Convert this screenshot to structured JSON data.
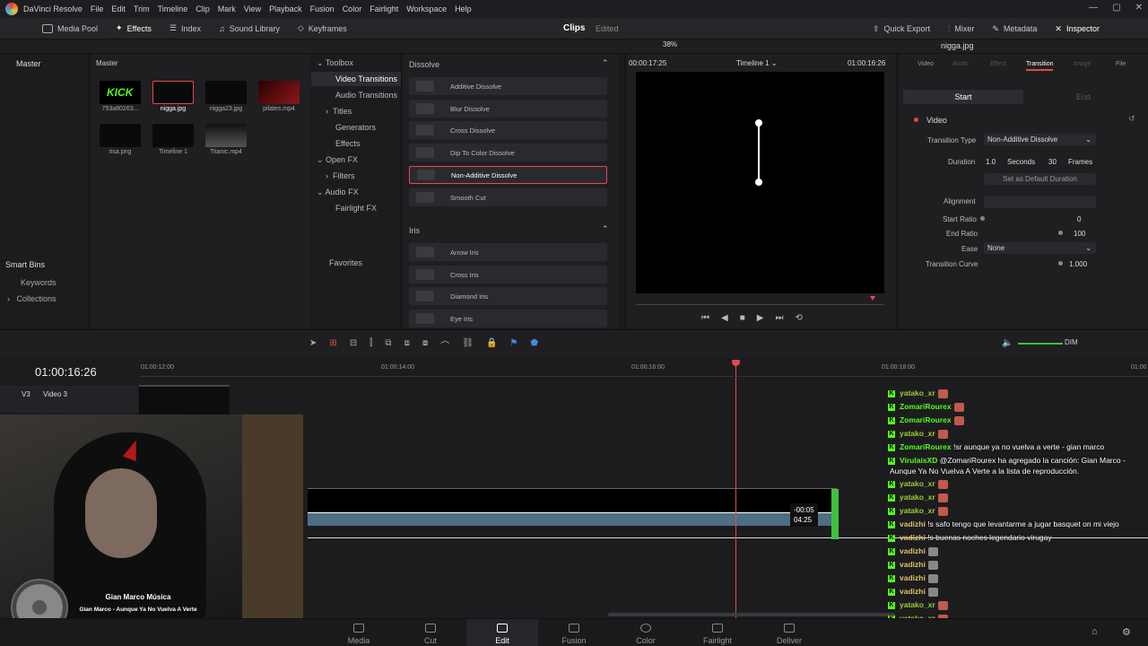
{
  "menubar": {
    "app": "DaVinci Resolve",
    "items": [
      "File",
      "Edit",
      "Trim",
      "Timeline",
      "Clip",
      "Mark",
      "View",
      "Playback",
      "Fusion",
      "Color",
      "Fairlight",
      "Workspace",
      "Help"
    ]
  },
  "toolbar": {
    "left": [
      "Media Pool",
      "Effects",
      "Index",
      "Sound Library",
      "Keyframes"
    ],
    "center_title": "Clips",
    "center_status": "Edited",
    "right": [
      "Quick Export",
      "Mixer",
      "Metadata",
      "Inspector"
    ]
  },
  "sidebar": {
    "master": "Master",
    "smart_bins": "Smart Bins",
    "keywords": "Keywords",
    "collections": "Collections"
  },
  "media_pool": {
    "title": "Master",
    "clips": [
      {
        "label": "753a80263..."
      },
      {
        "label": "nigga.jpg"
      },
      {
        "label": "nigga23.jpg"
      },
      {
        "label": "pilates.mp4"
      },
      {
        "label": "risa.png"
      },
      {
        "label": "Timeline 1"
      },
      {
        "label": "Titanic.mp4"
      }
    ],
    "kick_text": "KICK"
  },
  "toolbox": {
    "items": [
      "Toolbox",
      "Video Transitions",
      "Audio Transitions",
      "Titles",
      "Generators",
      "Effects",
      "Open FX",
      "Filters",
      "Audio FX",
      "Fairlight FX",
      "Favorites"
    ]
  },
  "effects": {
    "dissolve_header": "Dissolve",
    "dissolve": [
      "Additive Dissolve",
      "Blur Dissolve",
      "Cross Dissolve",
      "Dip To Color Dissolve",
      "Non-Additive Dissolve",
      "Smooth Cut"
    ],
    "iris_header": "Iris",
    "iris": [
      "Arrow Iris",
      "Cross Iris",
      "Diamond Iris",
      "Eye Iris"
    ]
  },
  "viewer": {
    "zoom": "38%",
    "timecode_left": "00:00:17:25",
    "timeline_name": "Timeline 1",
    "timecode_right": "01:00:16:26"
  },
  "inspector": {
    "filename": "nigga.jpg",
    "tabs": [
      "Video",
      "Audio",
      "Effect",
      "Transition",
      "Image",
      "File"
    ],
    "start": "Start",
    "end": "End",
    "section": "Video",
    "transition_type_label": "Transition Type",
    "transition_type": "Non-Additive Dissolve",
    "duration_label": "Duration",
    "duration_seconds": "1.0",
    "seconds_label": "Seconds",
    "duration_frames": "30",
    "frames_label": "Frames",
    "default_duration": "Set as Default Duration",
    "alignment_label": "Alignment",
    "start_ratio_label": "Start Ratio",
    "start_ratio": "0",
    "end_ratio_label": "End Ratio",
    "end_ratio": "100",
    "ease_label": "Ease",
    "ease": "None",
    "transition_curve_label": "Transition Curve",
    "transition_curve": "1.000"
  },
  "timeline": {
    "timecode": "01:00:16:26",
    "track": "V3",
    "track_name": "Video 3",
    "ruler": [
      "01:00:12:00",
      "01:00:14:00",
      "01:00:16:00",
      "01:00:18:00",
      "01:00"
    ],
    "dim": "DIM",
    "trim_offset": "-00:05",
    "trim_duration": "04:25"
  },
  "pages": [
    "Media",
    "Cut",
    "Edit",
    "Fusion",
    "Color",
    "Fairlight",
    "Deliver"
  ],
  "chat": [
    {
      "user": "yatako_xr",
      "color": "#9acd32",
      "msg": ""
    },
    {
      "user": "ZomariRourex",
      "color": "#53fc18",
      "msg": ""
    },
    {
      "user": "ZomariRourex",
      "color": "#53fc18",
      "msg": ""
    },
    {
      "user": "yatako_xr",
      "color": "#9acd32",
      "msg": ""
    },
    {
      "user": "ZomariRourex",
      "color": "#53fc18",
      "msg": "!sr aunque ya no vuelva a verte - gian marco"
    },
    {
      "user": "VirulaisXD",
      "color": "#53fc18",
      "msg": "@ZomariRourex ha agregado la canción: Gian Marco -"
    },
    {
      "user": "",
      "color": "#fff",
      "msg": "Aunque Ya No Vuelva A Verte a la lista de reproducción."
    },
    {
      "user": "yatako_xr",
      "color": "#9acd32",
      "msg": ""
    },
    {
      "user": "yatako_xr",
      "color": "#9acd32",
      "msg": ""
    },
    {
      "user": "yatako_xr",
      "color": "#9acd32",
      "msg": ""
    },
    {
      "user": "vadizhi",
      "color": "#e0c060",
      "msg": "!s safo tengo que levantarme a jugar basquet on mi viejo"
    },
    {
      "user": "vadizhi",
      "color": "#e0c060",
      "msg": "!s buenas noches legendario virugay"
    },
    {
      "user": "vadizhi",
      "color": "#e0c060",
      "msg": ""
    },
    {
      "user": "vadizhi",
      "color": "#e0c060",
      "msg": ""
    },
    {
      "user": "vadizhi",
      "color": "#e0c060",
      "msg": ""
    },
    {
      "user": "vadizhi",
      "color": "#e0c060",
      "msg": ""
    },
    {
      "user": "yatako_xr",
      "color": "#9acd32",
      "msg": ""
    },
    {
      "user": "yatako_xr",
      "color": "#9acd32",
      "msg": ""
    },
    {
      "user": "yatako_xr",
      "color": "#9acd32",
      "msg": ""
    },
    {
      "user": "yatako_xr",
      "color": "#9acd32",
      "msg": ""
    }
  ],
  "now_playing": {
    "title": "Gian Marco Música",
    "subtitle": "Gian Marco - Aunque Ya No Vuelva A Verte"
  }
}
